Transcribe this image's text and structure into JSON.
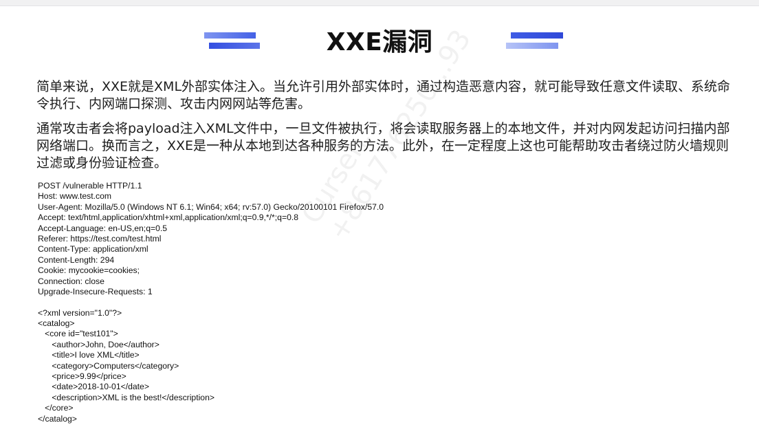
{
  "slide": {
    "title": "XXE漏洞",
    "paragraphs": [
      "简单来说，XXE就是XML外部实体注入。当允许引用外部实体时，通过构造恶意内容，就可能导致任意文件读取、系统命令执行、内网端口探测、攻击内网网站等危害。",
      "通常攻击者会将payload注入XML文件中，一旦文件被执行，将会读取服务器上的本地文件，并对内网发起访问扫描内部网络端口。换而言之，XXE是一种从本地到达各种服务的方法。此外，在一定程度上这也可能帮助攻击者绕过防火墙规则过滤或身份验证检查。"
    ],
    "code_lines": [
      "POST /vulnerable HTTP/1.1",
      "Host: www.test.com",
      "User-Agent: Mozilla/5.0 (Windows NT 6.1; Win64; x64; rv:57.0) Gecko/20100101 Firefox/57.0",
      "Accept: text/html,application/xhtml+xml,application/xml;q=0.9,*/*;q=0.8",
      "Accept-Language: en-US,en;q=0.5",
      "Referer: https://test.com/test.html",
      "Content-Type: application/xml",
      "Content-Length: 294",
      "Cookie: mycookie=cookies;",
      "Connection: close",
      "Upgrade-Insecure-Requests: 1",
      "",
      "<?xml version=\"1.0\"?>",
      "<catalog>",
      "   <core id=\"test101\">",
      "      <author>John, Doe</author>",
      "      <title>I love XML</title>",
      "      <category>Computers</category>",
      "      <price>9.99</price>",
      "      <date>2018-10-01</date>",
      "      <description>XML is the best!</description>",
      "   </core>",
      "</catalog>"
    ],
    "watermark": [
      "Cursen...",
      "+861776250...93"
    ]
  }
}
